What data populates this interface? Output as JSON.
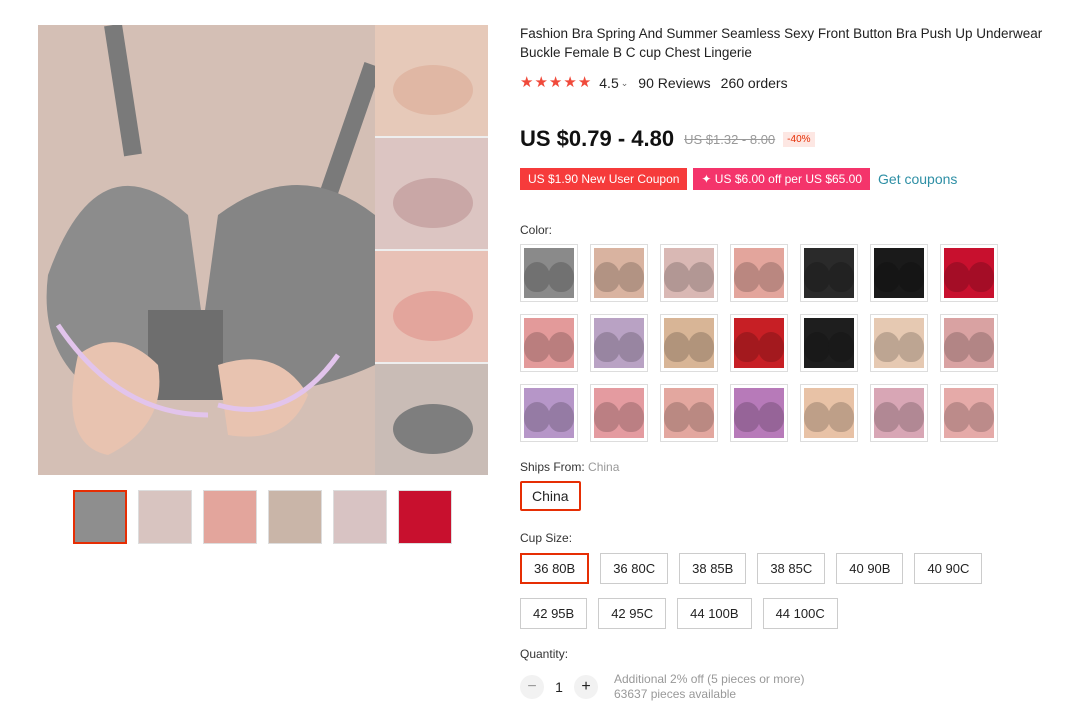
{
  "product": {
    "title": "Fashion Bra Spring And Summer Seamless Sexy Front Button Bra Push Up Underwear Buckle Female B C cup Chest Lingerie",
    "rating": "4.5",
    "reviews": "90 Reviews",
    "orders": "260 orders",
    "price": "US $0.79 - 4.80",
    "original_price": "US $1.32 - 8.00",
    "discount": "-40%",
    "coupons": [
      "US $1.90 New User Coupon",
      "✦ US $6.00 off per US $65.00"
    ],
    "get_coupons": "Get coupons"
  },
  "color": {
    "label": "Color:",
    "swatches": [
      "#8a8a8a",
      "#d9b3a0",
      "#d9b8b4",
      "#e3a59c",
      "#2a2a2a",
      "#1a1a1a",
      "#c8102e",
      "#e39a9a",
      "#b9a2c4",
      "#d8b596",
      "#c71f25",
      "#1e1e1e",
      "#e6c9b2",
      "#d9a2a2",
      "#b696c8",
      "#e49ba0",
      "#e3a79f",
      "#b77ab9",
      "#e8c2a6",
      "#d8a6b5",
      "#e5aaa8"
    ]
  },
  "ships": {
    "label": "Ships From:",
    "value": "China",
    "option": "China"
  },
  "cup": {
    "label": "Cup Size:",
    "options": [
      "36 80B",
      "36 80C",
      "38 85B",
      "38 85C",
      "40 90B",
      "40 90C",
      "42 95B",
      "42 95C",
      "44 100B",
      "44 100C"
    ]
  },
  "quantity": {
    "label": "Quantity:",
    "minus": "−",
    "plus": "+",
    "value": "1",
    "note": "Additional 2% off (5 pieces or more)",
    "available": "63637 pieces available"
  },
  "gallery": {
    "thumbs": [
      "#8e8e8e",
      "#d8c4c0",
      "#e3a59c",
      "#c9b5a8",
      "#d8c3c3",
      "#c8102e"
    ]
  }
}
